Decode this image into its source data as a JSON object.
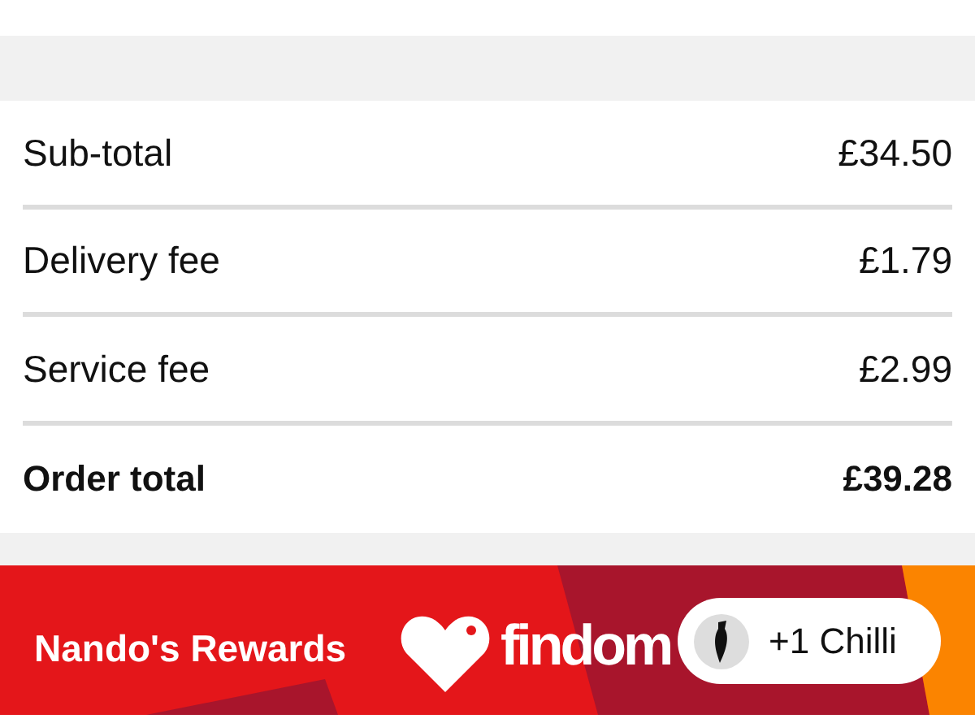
{
  "summary": {
    "rows": [
      {
        "kind": "line",
        "label": "Sub-total",
        "value": "£34.50"
      },
      {
        "kind": "line",
        "label": "Delivery fee",
        "value": "£1.79"
      },
      {
        "kind": "line",
        "label": "Service fee",
        "value": "£2.99"
      },
      {
        "kind": "total",
        "label": "Order total",
        "value": "£39.28"
      }
    ]
  },
  "rewards_banner": {
    "title": "Nando's Rewards",
    "logo_text": "findom"
  },
  "toast": {
    "text": "+1 Chilli"
  }
}
